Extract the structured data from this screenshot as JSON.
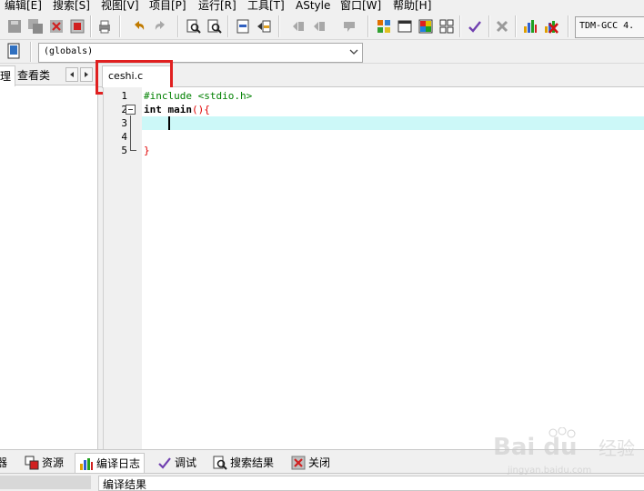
{
  "menu": {
    "items": [
      {
        "label": "编辑[E]"
      },
      {
        "label": "搜索[S]"
      },
      {
        "label": "视图[V]"
      },
      {
        "label": "项目[P]"
      },
      {
        "label": "运行[R]"
      },
      {
        "label": "工具[T]"
      },
      {
        "label": "AStyle"
      },
      {
        "label": "窗口[W]"
      },
      {
        "label": "帮助[H]"
      }
    ]
  },
  "toolbar": {
    "compiler": "TDM-GCC 4."
  },
  "scope": {
    "selected": "(globals)"
  },
  "left_panel": {
    "tabs": [
      {
        "label": "理"
      },
      {
        "label": "查看类"
      }
    ]
  },
  "editor": {
    "tab_label": "ceshi.c",
    "lines": [
      {
        "num": "1",
        "text": "#include <stdio.h>"
      },
      {
        "num": "2",
        "kw": "int",
        "text": " main",
        "punct": "(){"
      },
      {
        "num": "3",
        "text": ""
      },
      {
        "num": "4",
        "text": ""
      },
      {
        "num": "5",
        "text": "}"
      }
    ]
  },
  "bottom": {
    "tabs": [
      {
        "label": "器"
      },
      {
        "label": "资源"
      },
      {
        "label": "编译日志"
      },
      {
        "label": "调试"
      },
      {
        "label": "搜索结果"
      },
      {
        "label": "关闭"
      }
    ],
    "results_label": "编译结果"
  },
  "colors": {
    "preprocessor": "#008000",
    "keyword": "#000000",
    "brace": "#e00000",
    "current_line": "#ccf8f8",
    "highlight_box": "#e02020"
  },
  "watermark": {
    "logo": "Bai du",
    "sub": "经验",
    "url": "jingyan.baidu.com"
  }
}
